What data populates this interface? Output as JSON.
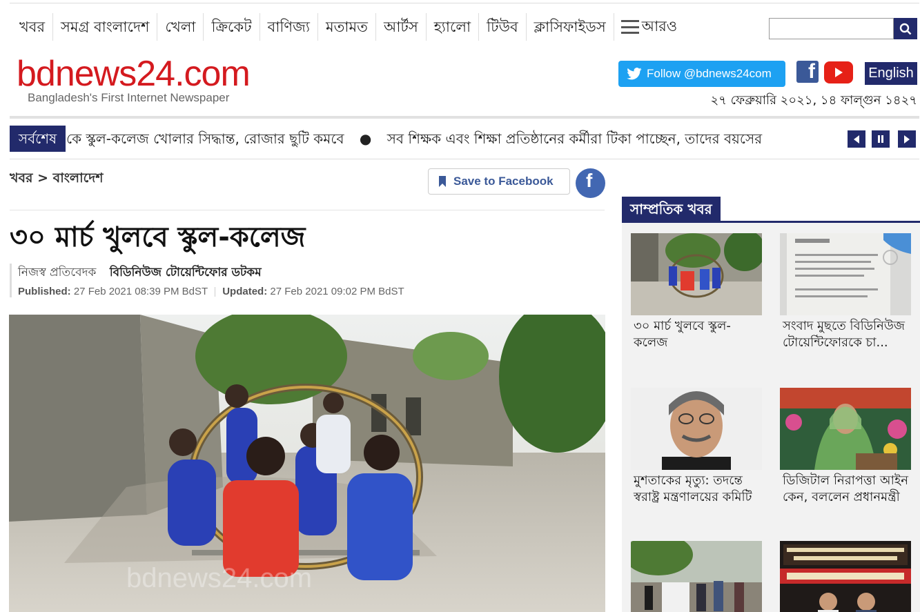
{
  "nav": {
    "items": [
      "খবর",
      "সমগ্র বাংলাদেশ",
      "খেলা",
      "ক্রিকেট",
      "বাণিজ্য",
      "মতামত",
      "আর্টস",
      "হ্যালো",
      "টিউব",
      "ক্লাসিফাইডস"
    ],
    "more_label": "আরও"
  },
  "search": {
    "placeholder": ""
  },
  "brand": {
    "logo": "bdnews24.com",
    "tagline": "Bangladesh's First Internet Newspaper",
    "follow_label": "Follow @bdnews24com",
    "english_label": "English",
    "date": "২৭ ফেব্রুয়ারি ২০২১, ১৪ ফাল্গুন ১৪২৭"
  },
  "ticker": {
    "label": "সর্বশেষ",
    "items": [
      "কে স্কুল-কলেজ খোলার সিদ্ধান্ত, রোজার ছুটি কমবে",
      "সব শিক্ষক এবং শিক্ষা প্রতিষ্ঠানের কর্মীরা টিকা পাচ্ছেন, তাদের বয়সের"
    ],
    "dot": "●"
  },
  "article": {
    "breadcrumb": "খবর > বাংলাদেশ",
    "save_label": "Save to Facebook",
    "headline": "৩০ মার্চ খুলবে স্কুল-কলেজ",
    "reporter": "নিজস্ব প্রতিবেদক",
    "outlet": "বিডিনিউজ টোয়েন্টিফোর ডটকম",
    "published_label": "Published:",
    "published": "27 Feb 2021 08:39 PM BdST",
    "updated_label": "Updated:",
    "updated": "27 Feb 2021 09:02 PM BdST"
  },
  "sidebar": {
    "title": "সাম্প্রতিক খবর",
    "cards": [
      {
        "caption": "৩০ মার্চ খুলবে স্কুল-কলেজ"
      },
      {
        "caption": "সংবাদ মুছতে বিডিনিউজ টোয়েন্টিফোরকে চা..."
      },
      {
        "caption": "মুশতাকের মৃত্যু: তদন্তে স্বরাষ্ট্র মন্ত্রণালয়ের কমিটি"
      },
      {
        "caption": "ডিজিটাল নিরাপত্তা আইন কেন, বললেন প্রধানমন্ত্রী"
      },
      {
        "caption": ""
      },
      {
        "caption": ""
      }
    ]
  },
  "colors": {
    "navy": "#222a6b",
    "logo_red": "#d41a1f",
    "twitter": "#1da1f2",
    "facebook": "#3b5998",
    "youtube": "#e62117"
  }
}
